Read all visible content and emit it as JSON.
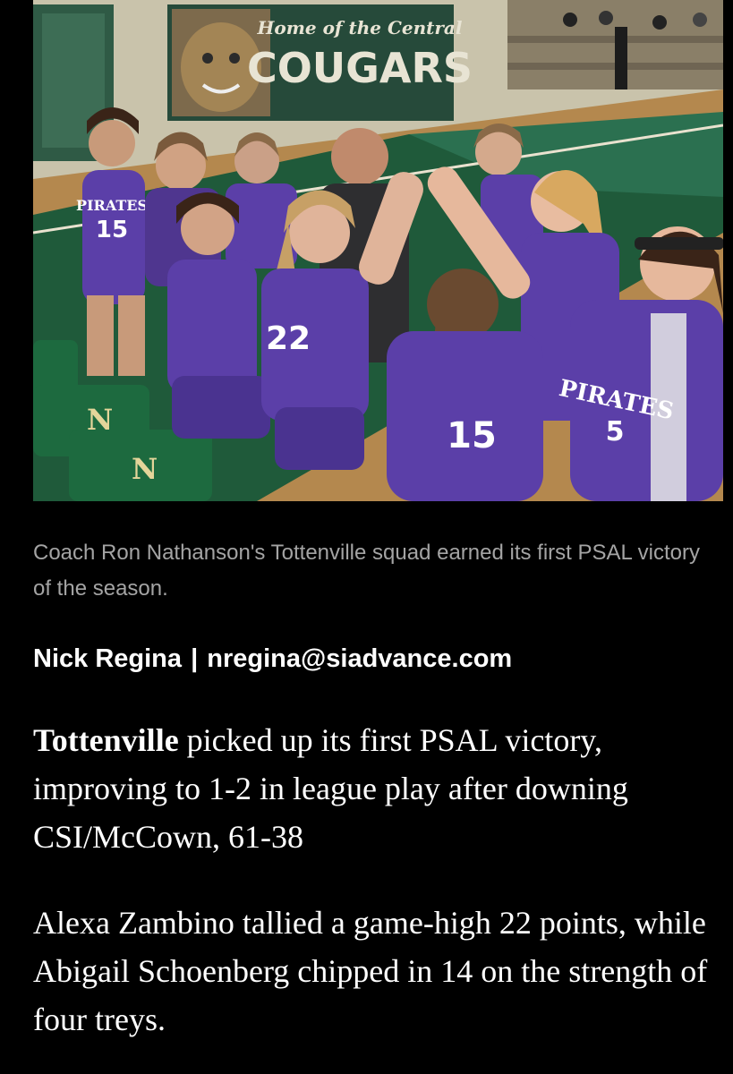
{
  "photo": {
    "banner_line1": "Home of the Central",
    "banner_line2": "COUGARS",
    "jerseys": [
      {
        "team": "PIRATES",
        "number": "15"
      },
      {
        "team": "",
        "number": "22"
      },
      {
        "team": "",
        "number": "15"
      },
      {
        "team": "PIRATES",
        "number": "5"
      }
    ]
  },
  "caption": "Coach Ron Nathanson's Tottenville squad earned its first PSAL victory of the season.",
  "byline": {
    "author": "Nick Regina",
    "separator": "|",
    "email": "nregina@siadvance.com"
  },
  "article": {
    "p1_lead": "Tottenville",
    "p1_rest": " picked up its first PSAL victory, improving to 1-2 in league play after downing CSI/McCown, 61-38",
    "p2": "Alexa Zambino tallied a game-high 22 points, while Abigail Schoenberg chipped in 14 on the strength of four treys."
  },
  "colors": {
    "background": "#000000",
    "caption_text": "#a4a4a4",
    "body_text": "#ffffff",
    "jersey_purple": "#5b3fa8",
    "court_green": "#1f5a3a"
  }
}
